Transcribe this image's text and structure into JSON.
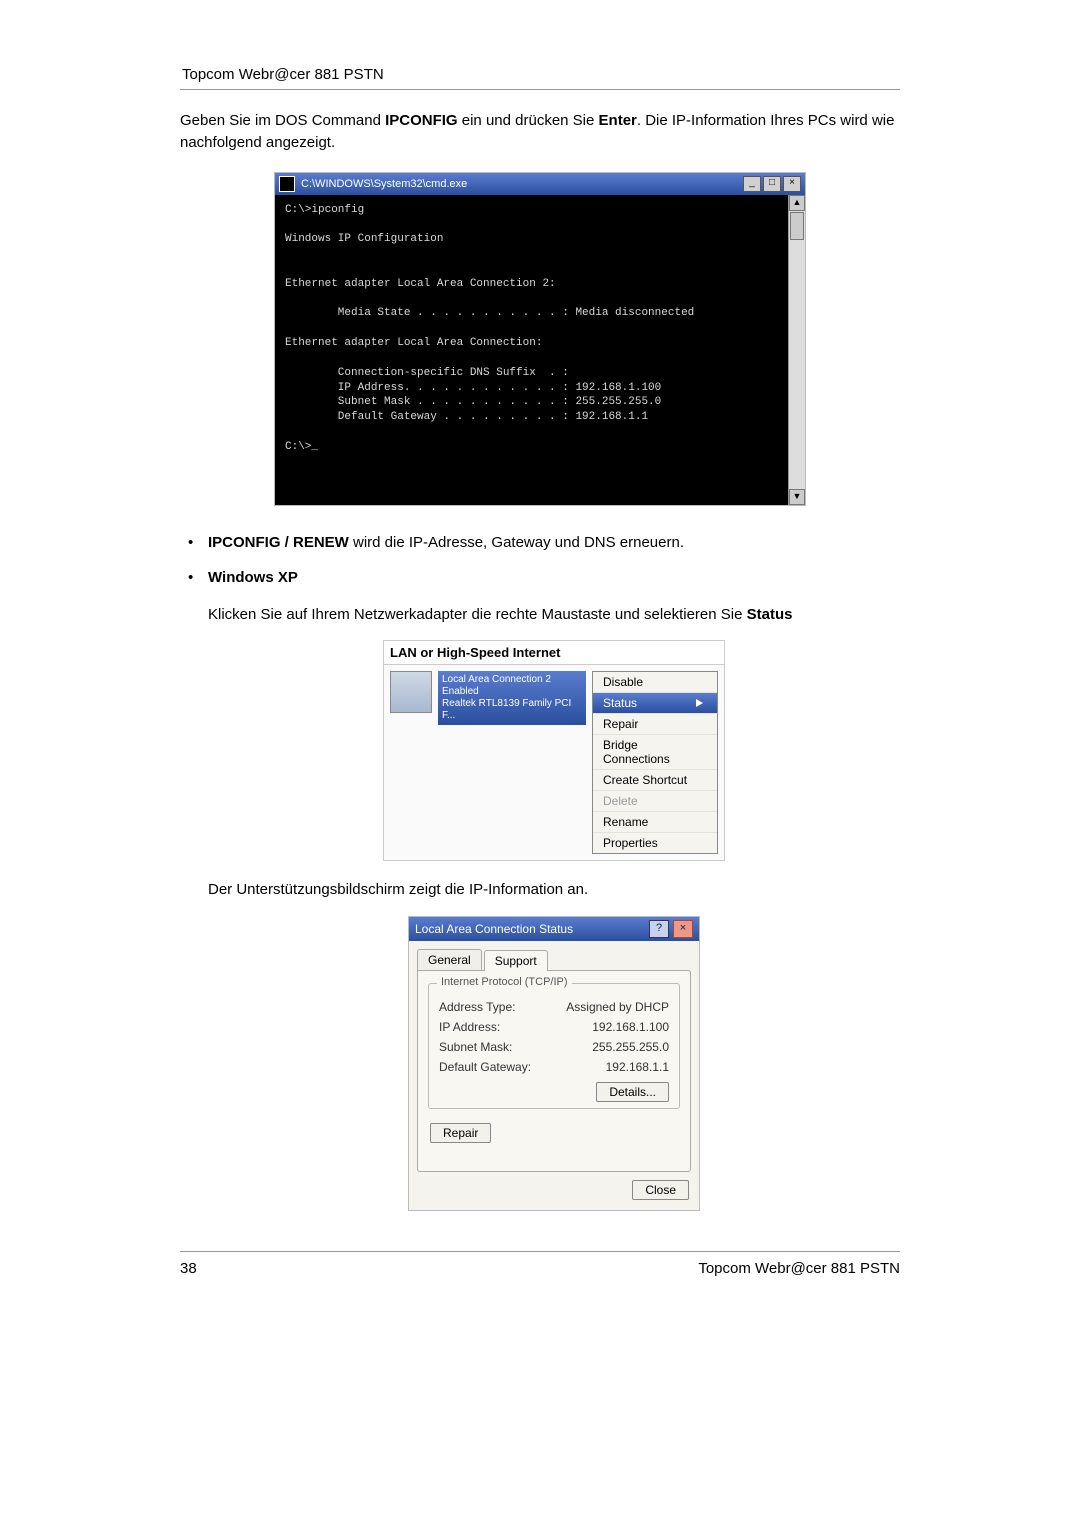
{
  "header": "Topcom Webr@cer 881 PSTN",
  "intro_pre": "Geben Sie im DOS Command ",
  "intro_cmd": "IPCONFIG",
  "intro_mid": " ein und drücken Sie ",
  "intro_enter": "Enter",
  "intro_post": ". Die IP-Information Ihres PCs wird wie nachfolgend angezeigt.",
  "cmd": {
    "title": "C:\\WINDOWS\\System32\\cmd.exe",
    "min": "_",
    "max": "□",
    "close": "×",
    "up": "▲",
    "down": "▼",
    "body": "C:\\>ipconfig\n\nWindows IP Configuration\n\n\nEthernet adapter Local Area Connection 2:\n\n        Media State . . . . . . . . . . . : Media disconnected\n\nEthernet adapter Local Area Connection:\n\n        Connection-specific DNS Suffix  . :\n        IP Address. . . . . . . . . . . . : 192.168.1.100\n        Subnet Mask . . . . . . . . . . . : 255.255.255.0\n        Default Gateway . . . . . . . . . : 192.168.1.1\n\nC:\\>_"
  },
  "bullet1_b": "IPCONFIG / RENEW",
  "bullet1_rest": " wird die IP-Adresse, Gateway und DNS erneuern.",
  "bullet2_b": "Windows XP",
  "xp_pre": "Klicken Sie auf Ihrem Netzwerkadapter die rechte Maustaste und selektieren Sie ",
  "xp_bold": "Status",
  "lan": {
    "header": "LAN or High-Speed Internet",
    "desc_l1": "Local Area Connection 2",
    "desc_l2": "Enabled",
    "desc_l3": "Realtek RTL8139 Family PCI F...",
    "menu": {
      "disable": "Disable",
      "status": "Status",
      "repair": "Repair",
      "bridge": "Bridge Connections",
      "shortcut": "Create Shortcut",
      "delete": "Delete",
      "rename": "Rename",
      "properties": "Properties"
    }
  },
  "support_text": "Der Unterstützungsbildschirm zeigt die IP-Information an.",
  "stat": {
    "title": "Local Area Connection Status",
    "help": "?",
    "close": "×",
    "tab_general": "General",
    "tab_support": "Support",
    "group": "Internet Protocol (TCP/IP)",
    "rows": {
      "addr_type_l": "Address Type:",
      "addr_type_v": "Assigned by DHCP",
      "ip_l": "IP Address:",
      "ip_v": "192.168.1.100",
      "mask_l": "Subnet Mask:",
      "mask_v": "255.255.255.0",
      "gw_l": "Default Gateway:",
      "gw_v": "192.168.1.1"
    },
    "details": "Details...",
    "repair": "Repair",
    "close_btn": "Close"
  },
  "footer_page": "38",
  "footer_right": "Topcom Webr@cer 881 PSTN"
}
